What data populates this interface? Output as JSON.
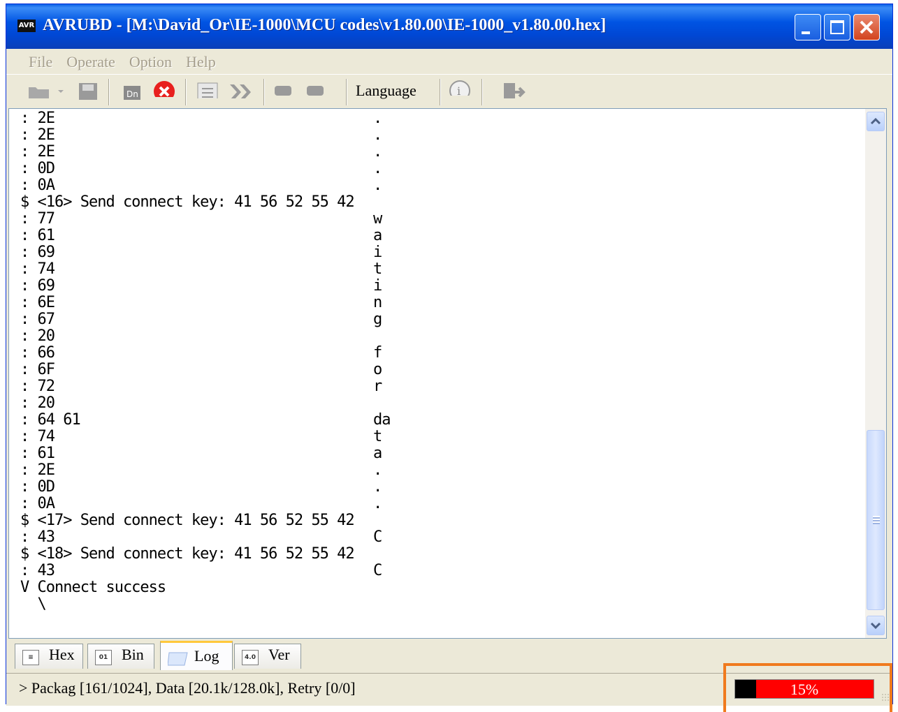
{
  "window": {
    "title": "AVRUBD - [M:\\David_Or\\IE-1000\\MCU codes\\v1.80.00\\IE-1000_v1.80.00.hex]",
    "app_badge": "AVR"
  },
  "menu": [
    "File",
    "Operate",
    "Option",
    "Help"
  ],
  "toolbar": {
    "language_label": "Language",
    "icons": [
      "open-folder-icon",
      "dropdown-arrow-icon",
      "save-icon",
      "download-chip-icon",
      "stop-icon",
      "list-icon",
      "fast-forward-icon",
      "option-icon",
      "option2-icon",
      "info-icon",
      "exit-icon"
    ]
  },
  "log_lines": [
    {
      "hex": ": 2E",
      "ascii": "."
    },
    {
      "hex": ": 2E",
      "ascii": "."
    },
    {
      "hex": ": 2E",
      "ascii": "."
    },
    {
      "hex": ": 0D",
      "ascii": "."
    },
    {
      "hex": ": 0A",
      "ascii": "."
    },
    {
      "hex": "$ <16> Send connect key: 41 56 52 55 42",
      "ascii": ""
    },
    {
      "hex": ": 77",
      "ascii": "w"
    },
    {
      "hex": ": 61",
      "ascii": "a"
    },
    {
      "hex": ": 69",
      "ascii": "i"
    },
    {
      "hex": ": 74",
      "ascii": "t"
    },
    {
      "hex": ": 69",
      "ascii": "i"
    },
    {
      "hex": ": 6E",
      "ascii": "n"
    },
    {
      "hex": ": 67",
      "ascii": "g"
    },
    {
      "hex": ": 20",
      "ascii": ""
    },
    {
      "hex": ": 66",
      "ascii": "f"
    },
    {
      "hex": ": 6F",
      "ascii": "o"
    },
    {
      "hex": ": 72",
      "ascii": "r"
    },
    {
      "hex": ": 20",
      "ascii": ""
    },
    {
      "hex": ": 64 61",
      "ascii": "da"
    },
    {
      "hex": ": 74",
      "ascii": "t"
    },
    {
      "hex": ": 61",
      "ascii": "a"
    },
    {
      "hex": ": 2E",
      "ascii": "."
    },
    {
      "hex": ": 0D",
      "ascii": "."
    },
    {
      "hex": ": 0A",
      "ascii": "."
    },
    {
      "hex": "$ <17> Send connect key: 41 56 52 55 42",
      "ascii": ""
    },
    {
      "hex": ": 43",
      "ascii": "C"
    },
    {
      "hex": "$ <18> Send connect key: 41 56 52 55 42",
      "ascii": ""
    },
    {
      "hex": ": 43",
      "ascii": "C"
    },
    {
      "hex": "V Connect success",
      "ascii": ""
    },
    {
      "hex": "  \\",
      "ascii": ""
    }
  ],
  "tabs": [
    {
      "label": "Hex",
      "icon": "hex-doc-icon",
      "active": false
    },
    {
      "label": "Bin",
      "icon": "binary-icon",
      "active": false
    },
    {
      "label": "Log",
      "icon": "log-icon",
      "active": true
    },
    {
      "label": "Ver",
      "icon": "version-icon",
      "active": false
    }
  ],
  "tab_icon_text": {
    "bin": "01",
    "ver": "4.0"
  },
  "status": {
    "text": "> Packag [161/1024], Data [20.1k/128.0k], Retry [0/0]",
    "progress_label": "15%",
    "progress_fraction": 0.15
  },
  "colors": {
    "progress_bg": "#ff0000",
    "progress_fill": "#000000",
    "highlight": "#f07a1e",
    "titlebar": "#0054e3"
  }
}
